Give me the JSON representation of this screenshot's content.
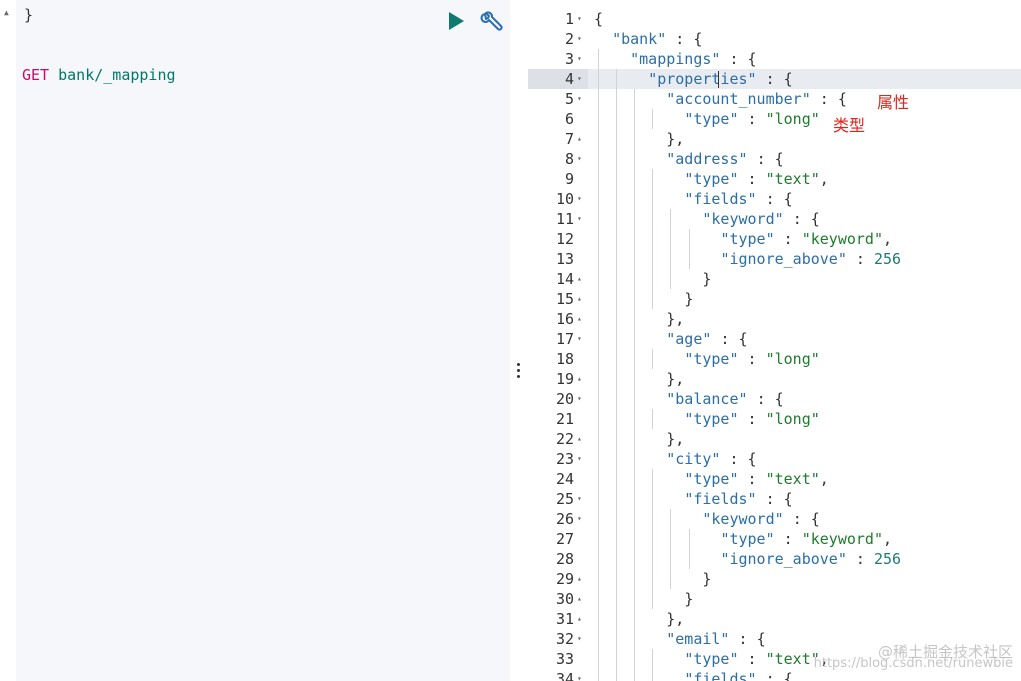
{
  "request_editor": {
    "closing_brace": "}",
    "method": "GET",
    "path": "bank/_mapping",
    "run_icon": "play-icon",
    "settings_icon": "wrench-icon"
  },
  "response_viewer": {
    "active_line": 4,
    "lines": [
      {
        "n": "1",
        "fold": "▾",
        "text": "{"
      },
      {
        "n": "2",
        "fold": "▾",
        "text": "  \"bank\" : {"
      },
      {
        "n": "3",
        "fold": "▾",
        "text": "    \"mappings\" : {"
      },
      {
        "n": "4",
        "fold": "▾",
        "text": "      \"properties\" : {"
      },
      {
        "n": "5",
        "fold": "▾",
        "text": "        \"account_number\" : {"
      },
      {
        "n": "6",
        "fold": "",
        "text": "          \"type\" : \"long\""
      },
      {
        "n": "7",
        "fold": "▴",
        "text": "        },"
      },
      {
        "n": "8",
        "fold": "▾",
        "text": "        \"address\" : {"
      },
      {
        "n": "9",
        "fold": "",
        "text": "          \"type\" : \"text\","
      },
      {
        "n": "10",
        "fold": "▾",
        "text": "          \"fields\" : {"
      },
      {
        "n": "11",
        "fold": "▾",
        "text": "            \"keyword\" : {"
      },
      {
        "n": "12",
        "fold": "",
        "text": "              \"type\" : \"keyword\","
      },
      {
        "n": "13",
        "fold": "",
        "text": "              \"ignore_above\" : 256"
      },
      {
        "n": "14",
        "fold": "▴",
        "text": "            }"
      },
      {
        "n": "15",
        "fold": "▴",
        "text": "          }"
      },
      {
        "n": "16",
        "fold": "▴",
        "text": "        },"
      },
      {
        "n": "17",
        "fold": "▾",
        "text": "        \"age\" : {"
      },
      {
        "n": "18",
        "fold": "",
        "text": "          \"type\" : \"long\""
      },
      {
        "n": "19",
        "fold": "▴",
        "text": "        },"
      },
      {
        "n": "20",
        "fold": "▾",
        "text": "        \"balance\" : {"
      },
      {
        "n": "21",
        "fold": "",
        "text": "          \"type\" : \"long\""
      },
      {
        "n": "22",
        "fold": "▴",
        "text": "        },"
      },
      {
        "n": "23",
        "fold": "▾",
        "text": "        \"city\" : {"
      },
      {
        "n": "24",
        "fold": "",
        "text": "          \"type\" : \"text\","
      },
      {
        "n": "25",
        "fold": "▾",
        "text": "          \"fields\" : {"
      },
      {
        "n": "26",
        "fold": "▾",
        "text": "            \"keyword\" : {"
      },
      {
        "n": "27",
        "fold": "",
        "text": "              \"type\" : \"keyword\","
      },
      {
        "n": "28",
        "fold": "",
        "text": "              \"ignore_above\" : 256"
      },
      {
        "n": "29",
        "fold": "▴",
        "text": "            }"
      },
      {
        "n": "30",
        "fold": "▴",
        "text": "          }"
      },
      {
        "n": "31",
        "fold": "▴",
        "text": "        },"
      },
      {
        "n": "32",
        "fold": "▾",
        "text": "        \"email\" : {"
      },
      {
        "n": "33",
        "fold": "",
        "text": "          \"type\" : \"text\","
      },
      {
        "n": "34",
        "fold": "▾",
        "text": "          \"fields\" : {"
      }
    ]
  },
  "annotations": {
    "attribute_label": "属性",
    "type_label": "类型"
  },
  "watermark": {
    "brand": "@稀土掘金技术社区",
    "url": "https://blog.csdn.net/runewbie"
  },
  "colors": {
    "method": "#c80a68",
    "path": "#00786a",
    "json_key": "#2c6ea8",
    "json_string": "#1e7c2c",
    "json_number": "#1c7a7a",
    "annotation": "#e2231a",
    "play_icon": "#107a70",
    "wrench_icon": "#2a6fb0"
  }
}
